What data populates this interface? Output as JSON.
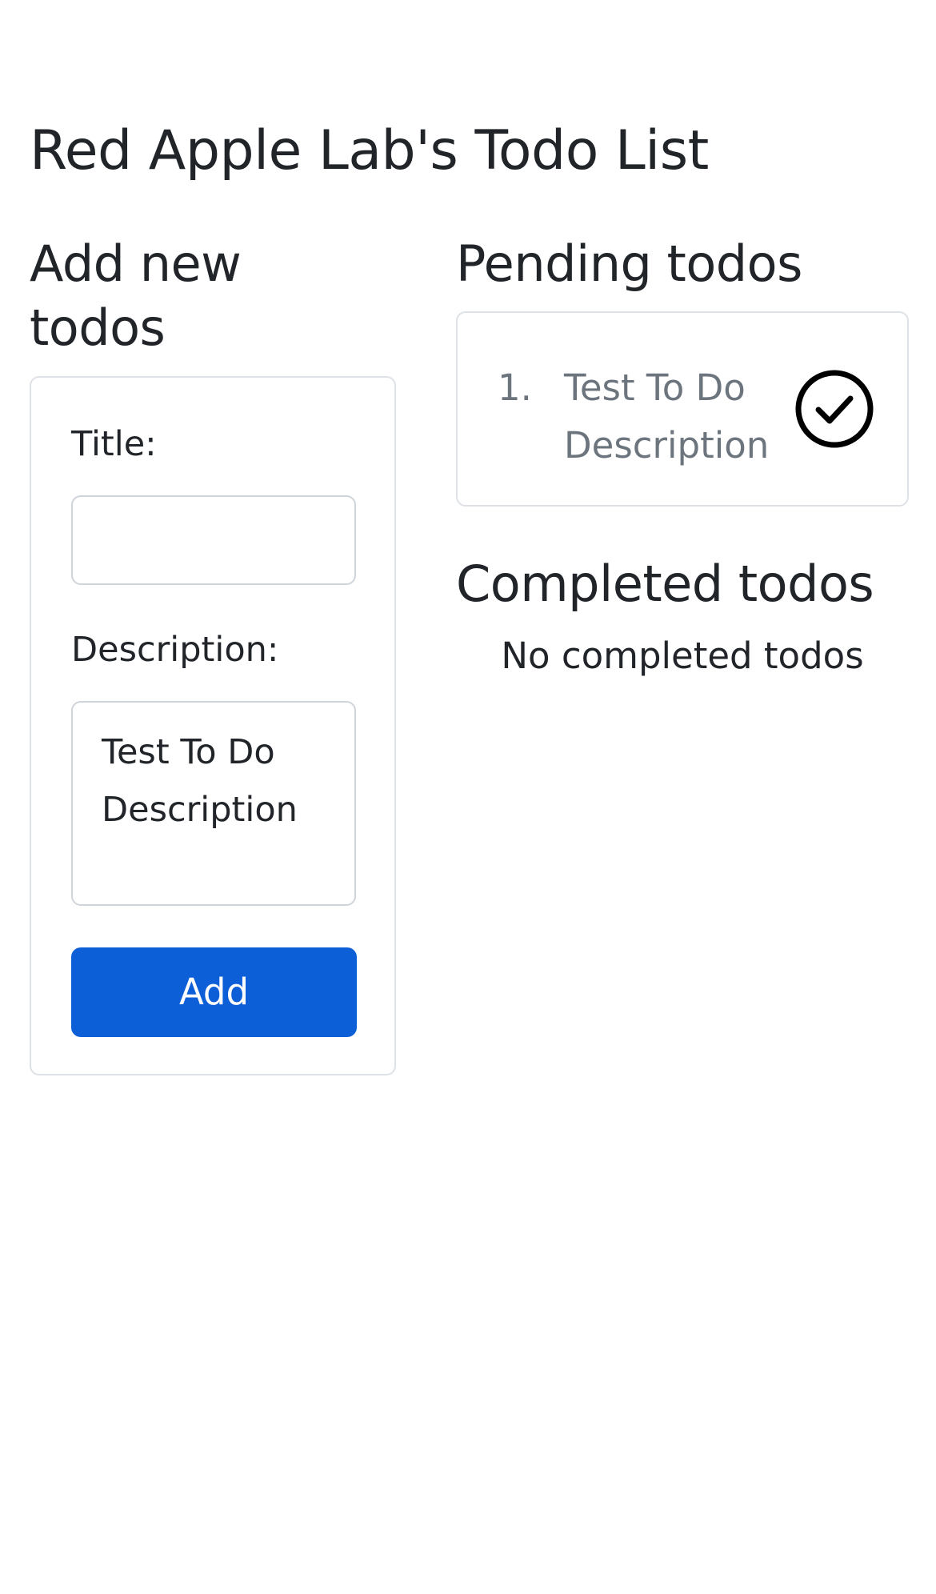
{
  "page": {
    "title": "Red Apple Lab's Todo List"
  },
  "add_section": {
    "heading": "Add new todos",
    "title_label": "Title:",
    "title_value": "",
    "description_label": "Description:",
    "description_value": "Test To Do Description",
    "add_button_label": "Add",
    "accent_color": "#0d5fd8"
  },
  "pending_section": {
    "heading": "Pending todos",
    "items": [
      {
        "number": "1.",
        "text": "Test To Do Description",
        "icon": "check-circle-icon"
      }
    ]
  },
  "completed_section": {
    "heading": "Completed todos",
    "empty_message": "No completed todos"
  }
}
